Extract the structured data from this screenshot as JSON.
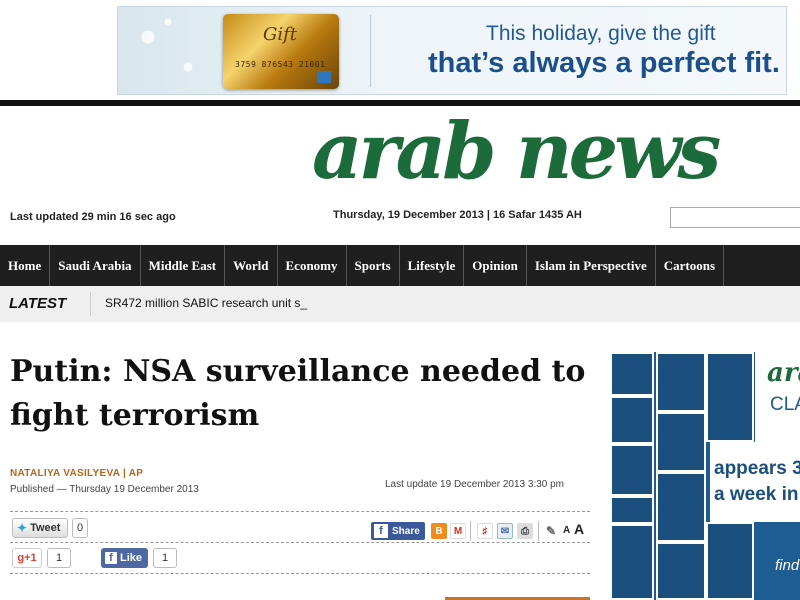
{
  "ad_banner": {
    "card_title": "Gift",
    "card_number": "3759 876543 21001",
    "line1": "This holiday, give the gift",
    "line2": "that’s always a perfect fit."
  },
  "logo": {
    "text": "arab news"
  },
  "header": {
    "last_updated": "Last updated 29 min 16 sec ago",
    "date": "Thursday, 19 December 2013 | 16 Safar 1435 AH"
  },
  "nav": {
    "items": [
      "Home",
      "Saudi Arabia",
      "Middle East",
      "World",
      "Economy",
      "Sports",
      "Lifestyle",
      "Opinion",
      "Islam in Perspective",
      "Cartoons"
    ]
  },
  "latest": {
    "label": "LATEST",
    "text": "SR472 million SABIC research unit s_"
  },
  "article": {
    "headline": "Putin: NSA surveillance needed to fight terrorism",
    "byline": "NATALIYA VASILYEVA | AP",
    "published": "Published — Thursday 19 December 2013",
    "last_update": "Last update 19 December 2013 3:30 pm"
  },
  "social": {
    "tweet_label": "Tweet",
    "tweet_count": "0",
    "gplus_label": "g+1",
    "gplus_count": "1",
    "fb_like_label": "Like",
    "fb_like_count": "1",
    "share_label": "Share",
    "font_small": "A",
    "font_large": "A"
  },
  "right_ad": {
    "logo": "arab",
    "cla": "CLA",
    "line1": "appears 3",
    "line2": "a week in",
    "find": "find"
  }
}
